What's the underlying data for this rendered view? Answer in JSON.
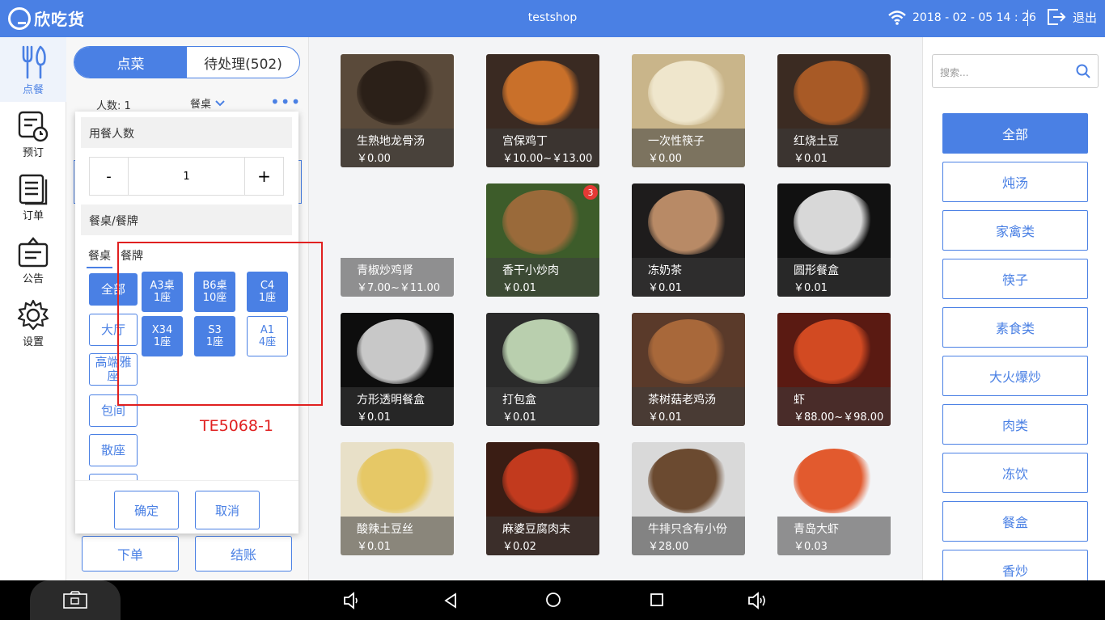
{
  "topbar": {
    "logo_text": "欣吃货",
    "shop_name": "testshop",
    "datetime": "2018 - 02 - 05  14 : 26",
    "logout_label": "退出"
  },
  "nav": [
    {
      "label": "点餐",
      "icon": "utensils-icon"
    },
    {
      "label": "预订",
      "icon": "reservation-clock-icon"
    },
    {
      "label": "订单",
      "icon": "order-list-icon"
    },
    {
      "label": "公告",
      "icon": "notice-board-icon"
    },
    {
      "label": "设置",
      "icon": "gear-icon"
    }
  ],
  "order_panel": {
    "tab_order": "点菜",
    "tab_pending": "待处理(502)",
    "people_label": "人数: 1",
    "table_label": "餐桌",
    "submit": "下单",
    "checkout": "结账"
  },
  "popup": {
    "diners_title": "用餐人数",
    "minus": "-",
    "count": "1",
    "plus": "+",
    "table_section_title": "餐桌/餐牌",
    "tab_table": "餐桌",
    "tab_card": "餐牌",
    "areas": [
      "全部",
      "大厅",
      "高端雅座",
      "包间",
      "散座"
    ],
    "tables": [
      {
        "name": "A3桌",
        "seats": "1座",
        "selected": true
      },
      {
        "name": "B6桌",
        "seats": "10座",
        "selected": true
      },
      {
        "name": "C4",
        "seats": "1座",
        "selected": true
      },
      {
        "name": "X34",
        "seats": "1座",
        "selected": true
      },
      {
        "name": "S3",
        "seats": "1座",
        "selected": true
      },
      {
        "name": "A1",
        "seats": "4座",
        "selected": false
      }
    ],
    "confirm": "确定",
    "cancel": "取消"
  },
  "annotation": "TE5068-1",
  "dishes": [
    {
      "name": "生熟地龙骨汤",
      "price": "￥0.00",
      "bg": "#5a4a3a",
      "plate": "#2b2018"
    },
    {
      "name": "宫保鸡丁",
      "price": "￥10.00~￥13.00",
      "bg": "#3a2a22",
      "plate": "#c9702a"
    },
    {
      "name": "一次性筷子",
      "price": "￥0.00",
      "bg": "#c9b58a",
      "plate": "#efe6cc"
    },
    {
      "name": "红烧土豆",
      "price": "￥0.01",
      "bg": "#3b2b22",
      "plate": "#a85a26"
    },
    {
      "name": "青椒炒鸡肾",
      "price": "￥7.00~￥11.00",
      "bg": "#f3f4f6",
      "plate": "#f3f4f6"
    },
    {
      "name": "香干小炒肉",
      "price": "￥0.01",
      "bg": "#3d5c2a",
      "plate": "#9a6a3a",
      "badge": "3"
    },
    {
      "name": "冻奶茶",
      "price": "￥0.01",
      "bg": "#1e1c1c",
      "plate": "#b88a66"
    },
    {
      "name": "圆形餐盒",
      "price": "￥0.01",
      "bg": "#111111",
      "plate": "#d8d8d8"
    },
    {
      "name": "方形透明餐盒",
      "price": "￥0.01",
      "bg": "#0d0d0d",
      "plate": "#c8c8c8"
    },
    {
      "name": "打包盒",
      "price": "￥0.01",
      "bg": "#2a2a2a",
      "plate": "#b9cfae"
    },
    {
      "name": "茶树菇老鸡汤",
      "price": "￥0.01",
      "bg": "#5a3a2a",
      "plate": "#a8683a"
    },
    {
      "name": "虾",
      "price": "￥88.00~￥98.00",
      "bg": "#5a1a12",
      "plate": "#d24a22"
    },
    {
      "name": "酸辣土豆丝",
      "price": "￥0.01",
      "bg": "#e8e0c8",
      "plate": "#e6c866"
    },
    {
      "name": "麻婆豆腐肉末",
      "price": "￥0.02",
      "bg": "#3a1d14",
      "plate": "#c23a1e"
    },
    {
      "name": "牛排只含有小份",
      "price": "￥28.00",
      "bg": "#d9d9d9",
      "plate": "#6b4a30"
    },
    {
      "name": "青岛大虾",
      "price": "￥0.03",
      "bg": "#f3f4f6",
      "plate": "#e25a2e"
    }
  ],
  "search": {
    "placeholder": "搜索..."
  },
  "categories": [
    "全部",
    "炖汤",
    "家禽类",
    "筷子",
    "素食类",
    "大火爆炒",
    "肉类",
    "冻饮",
    "餐盒",
    "香炒"
  ],
  "colors": {
    "accent": "#4a80e4",
    "annotation": "#e02020"
  }
}
